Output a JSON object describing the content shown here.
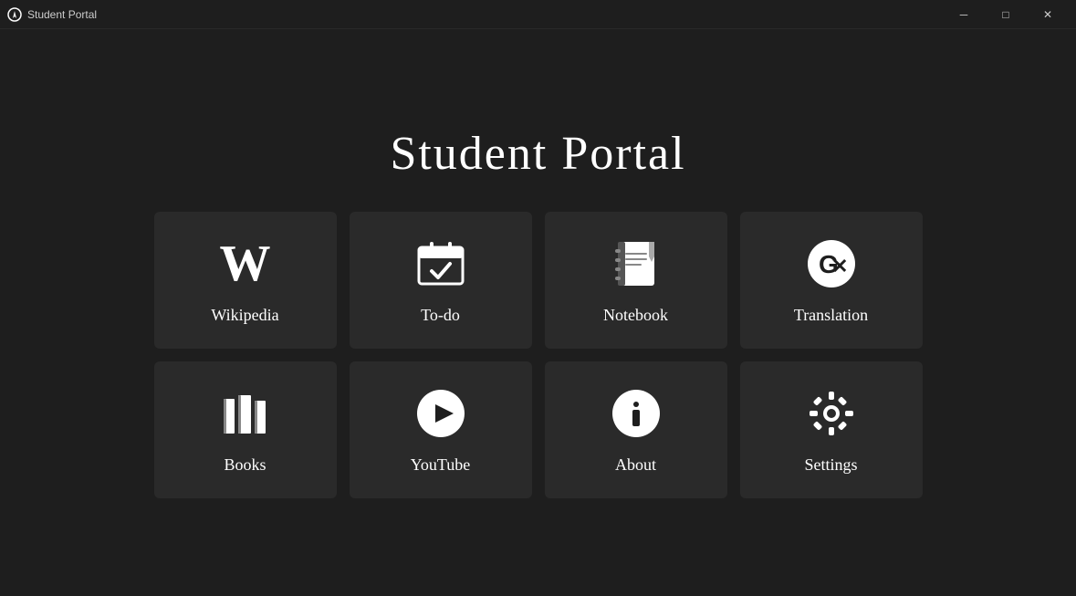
{
  "titlebar": {
    "title": "Student Portal",
    "minimize_label": "─",
    "maximize_label": "□",
    "close_label": "✕"
  },
  "main": {
    "heading": "Student Portal",
    "grid": [
      {
        "id": "wikipedia",
        "label": "Wikipedia",
        "icon": "wikipedia-icon"
      },
      {
        "id": "todo",
        "label": "To-do",
        "icon": "todo-icon"
      },
      {
        "id": "notebook",
        "label": "Notebook",
        "icon": "notebook-icon"
      },
      {
        "id": "translation",
        "label": "Translation",
        "icon": "translation-icon"
      },
      {
        "id": "books",
        "label": "Books",
        "icon": "books-icon"
      },
      {
        "id": "youtube",
        "label": "YouTube",
        "icon": "youtube-icon"
      },
      {
        "id": "about",
        "label": "About",
        "icon": "about-icon"
      },
      {
        "id": "settings",
        "label": "Settings",
        "icon": "settings-icon"
      }
    ]
  }
}
